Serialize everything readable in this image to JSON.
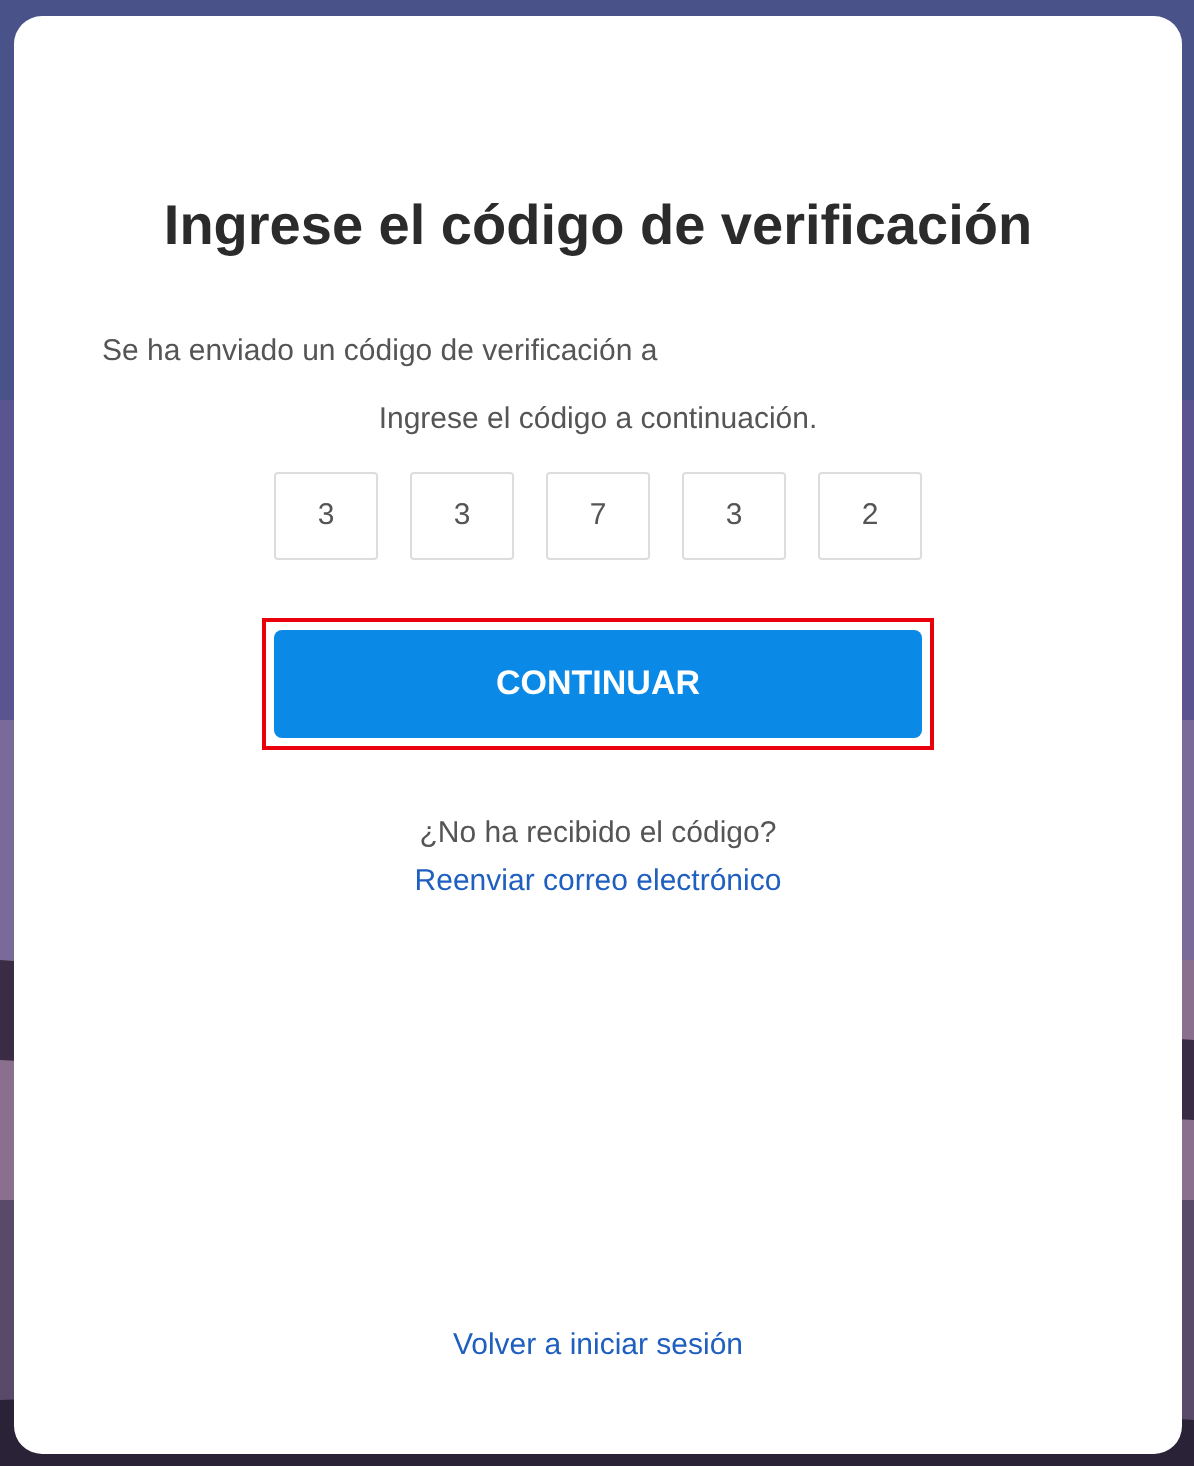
{
  "title": "Ingrese el código de verificación",
  "sent_message": "Se ha enviado un código de verificación a",
  "instruction": "Ingrese el código a continuación.",
  "code_digits": [
    "3",
    "3",
    "7",
    "3",
    "2"
  ],
  "continue_button": {
    "label": "CONTINUAR",
    "highlighted": true
  },
  "resend": {
    "question": "¿No ha recibido el código?",
    "link": "Reenviar correo electrónico"
  },
  "back_link": "Volver a iniciar sesión"
}
